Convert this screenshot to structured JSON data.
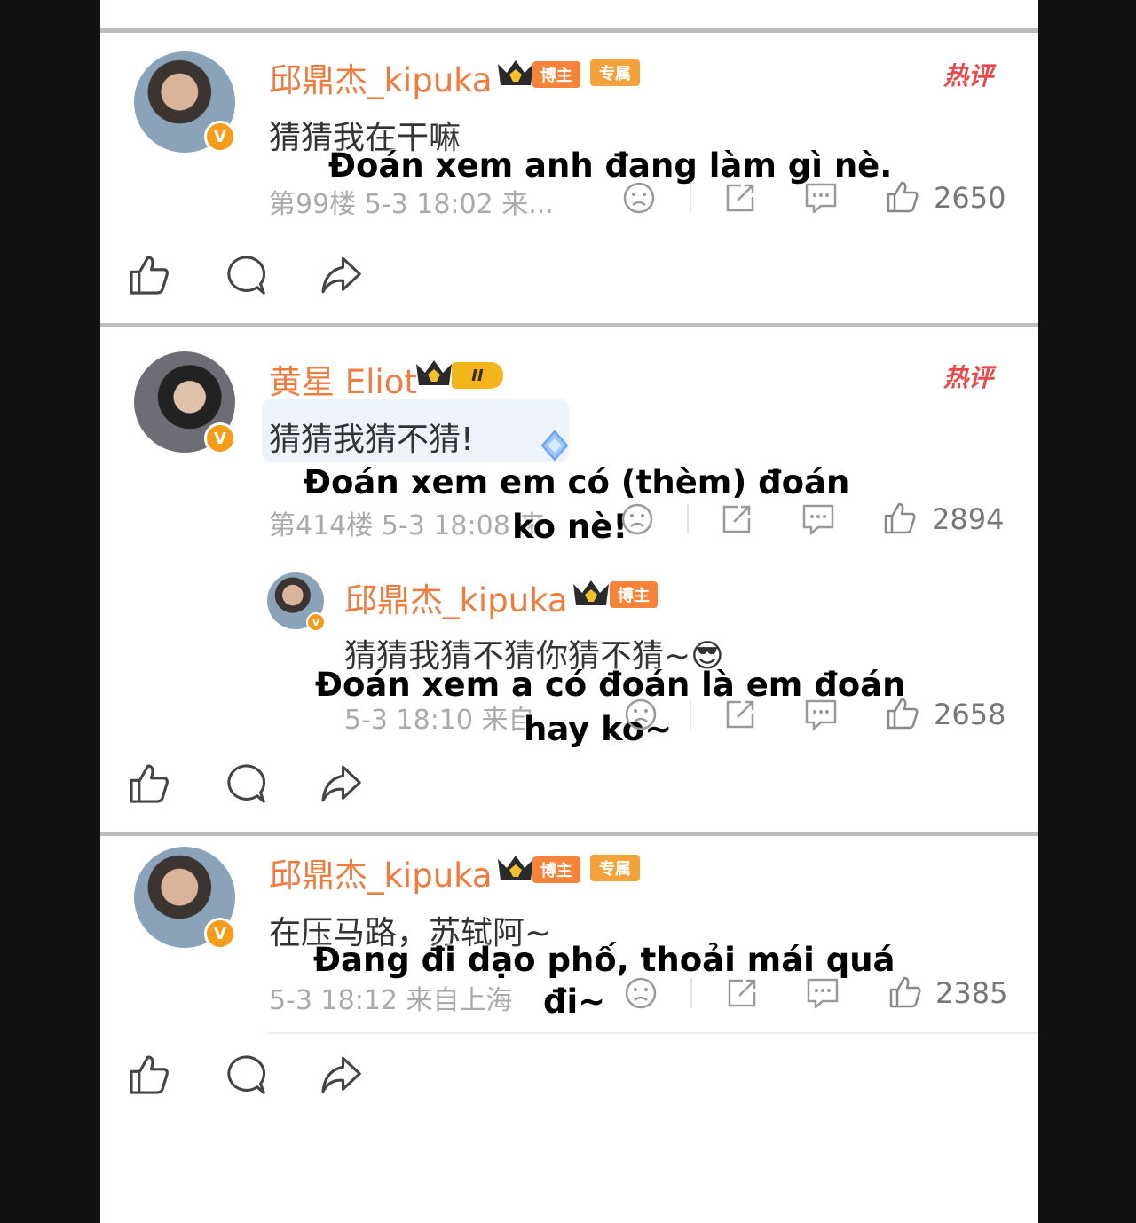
{
  "posts": [
    {
      "username": "邱鼎杰_kipuka",
      "badges": [
        "博主",
        "专属"
      ],
      "hot_label": "热评",
      "content": "猜猜我在干嘛",
      "caption": "Đoán xem anh đang làm gì nè.",
      "meta": "第99楼 5-3 18:02 来...",
      "likes": "2650"
    },
    {
      "username": "黄星 Eliot",
      "badges": [
        "II"
      ],
      "hot_label": "热评",
      "content": "猜猜我猜不猜!",
      "caption_line1": "Đoán xem em có (thèm) đoán",
      "caption_line2": "ko nè!",
      "meta": "第414楼 5-3 18:08 来",
      "likes": "2894",
      "reply": {
        "username": "邱鼎杰_kipuka",
        "badges": [
          "博主"
        ],
        "content": "猜猜我猜不猜你猜不猜~😎",
        "caption_line1": "Đoán xem a có đoán là em đoán",
        "caption_line2": "hay ko~",
        "meta": "5-3 18:10 来自",
        "likes": "2658"
      }
    },
    {
      "username": "邱鼎杰_kipuka",
      "badges": [
        "博主",
        "专属"
      ],
      "content": "在压马路，苏轼阿~",
      "caption_line1": "Đang đi dạo phố, thoải mái quá",
      "caption_line2": "đi~",
      "meta": "5-3 18:12 来自上海",
      "likes": "2385"
    }
  ],
  "icons": {
    "verified": "V",
    "like": "thumbs-up-icon",
    "comment": "comment-icon",
    "share": "share-icon",
    "sad": "sad-face-icon",
    "repost": "repost-icon",
    "reply": "reply-bubble-icon"
  },
  "colors": {
    "username": "#f07b3f",
    "hot": "#e9494a",
    "badge_blogger": "#f5843a",
    "badge_exclusive": "#f5a23a",
    "verified": "#f59c1a"
  }
}
